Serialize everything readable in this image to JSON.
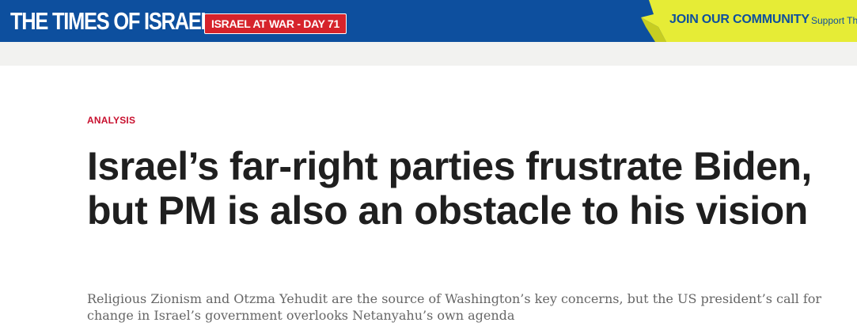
{
  "header": {
    "logo_text": "THE TIMES OF ISRAEL",
    "war_badge": "ISRAEL AT WAR - DAY 71",
    "join_label": "JOIN OUR COMMUNITY",
    "support_label": "Support Th",
    "colors": {
      "brand_blue": "#0d4f9e",
      "badge_red": "#d6232b",
      "community_yellow": "#e6ec36"
    }
  },
  "article": {
    "kicker": "ANALYSIS",
    "headline": "Israel’s far-right parties frustrate Biden, but PM is also an obstacle to his vision",
    "subheadline": "Religious Zionism and Otzma Yehudit are the source of Washington’s key concerns, but the US president’s call for change in Israel’s government overlooks Netanyahu’s own agenda"
  }
}
